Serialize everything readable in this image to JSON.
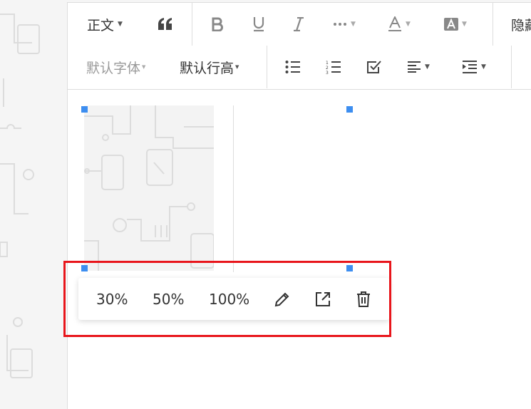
{
  "toolbar": {
    "row1": {
      "paragraph_style": "正文",
      "hidden_label": "隐藏"
    },
    "row2": {
      "font_family": "默认字体",
      "line_height": "默认行高"
    }
  },
  "image_popover": {
    "size_30": "30%",
    "size_50": "50%",
    "size_100": "100%"
  },
  "colors": {
    "accent": "#3d8ef0",
    "highlight": "#e8151b"
  },
  "icons": [
    "quote-icon",
    "bold-icon",
    "underline-icon",
    "italic-icon",
    "more-icon",
    "font-color-icon",
    "background-color-icon",
    "bulleted-list-icon",
    "numbered-list-icon",
    "todo-checkbox-icon",
    "align-icon",
    "indent-icon",
    "edit-pencil-icon",
    "open-external-icon",
    "trash-icon"
  ]
}
